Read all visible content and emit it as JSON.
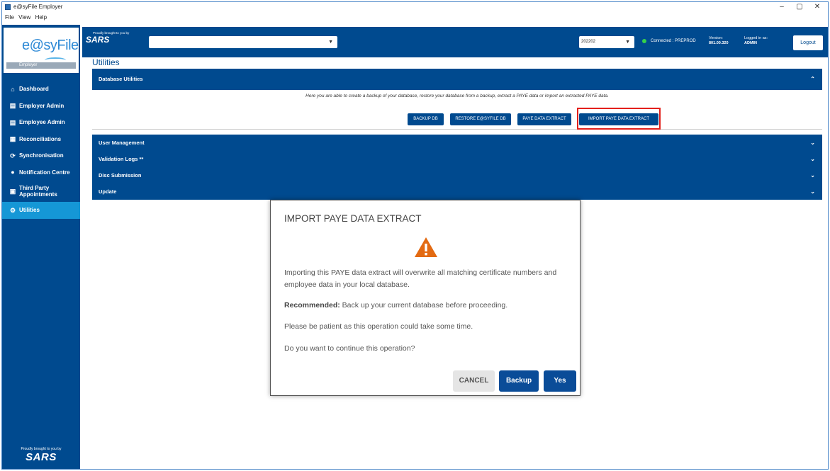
{
  "window": {
    "title": "e@syFile Employer",
    "min": "–",
    "max": "▢",
    "close": "✕"
  },
  "menu": [
    "File",
    "View",
    "Help"
  ],
  "logo": {
    "text": "e@syFile",
    "badge": "Employer"
  },
  "sidebar": {
    "items": [
      {
        "label": "Dashboard",
        "icon": "home-icon",
        "glyph": "⌂"
      },
      {
        "label": "Employer Admin",
        "icon": "document-icon",
        "glyph": "▤"
      },
      {
        "label": "Employee Admin",
        "icon": "document-icon",
        "glyph": "▤"
      },
      {
        "label": "Reconciliations",
        "icon": "reconcile-icon",
        "glyph": "▦"
      },
      {
        "label": "Synchronisation",
        "icon": "sync-icon",
        "glyph": "⟳"
      },
      {
        "label": "Notification Centre",
        "icon": "notification-icon",
        "glyph": "●"
      },
      {
        "label": "Third Party Appointments",
        "icon": "calendar-icon",
        "glyph": "▣"
      },
      {
        "label": "Utilities",
        "icon": "gears-icon",
        "glyph": "⚙"
      }
    ],
    "footer_small": "Proudly brought to you by",
    "footer_brand": "SARS"
  },
  "header": {
    "brand_small": "Proudly brought to you by",
    "brand": "SARS",
    "period": "202202",
    "connection": "Connected : PREPROD",
    "version_label": "Version:",
    "version": "801.00.320",
    "logged_label": "Logged in as:",
    "user": "ADMIN",
    "logout": "Logout",
    "status_color": "#36d14a"
  },
  "page": {
    "title": "Utilities"
  },
  "db_utilities": {
    "title": "Database Utilities",
    "description": "Here you are able to create a backup of your database, restore your database from a backup, extract a PAYE data or import an extracted PAYE data.",
    "buttons": [
      "BACKUP DB",
      "RESTORE E@SYFILE DB",
      "PAYE DATA EXTRACT",
      "IMPORT PAYE DATA EXTRACT"
    ]
  },
  "sections": [
    "User Management",
    "Validation Logs **",
    "Disc Submission",
    "Update"
  ],
  "modal": {
    "title": "IMPORT PAYE DATA EXTRACT",
    "line1": "Importing this PAYE data extract will overwrite all matching certificate numbers and employee data in your local database.",
    "recommended_label": "Recommended:",
    "recommended_text": " Back up your current database before proceeding.",
    "line3": "Please be patient as this operation could take some time.",
    "line4": "Do you want to continue this operation?",
    "cancel": "CANCEL",
    "backup": "Backup",
    "yes": "Yes",
    "warning_color": "#e36a12"
  }
}
